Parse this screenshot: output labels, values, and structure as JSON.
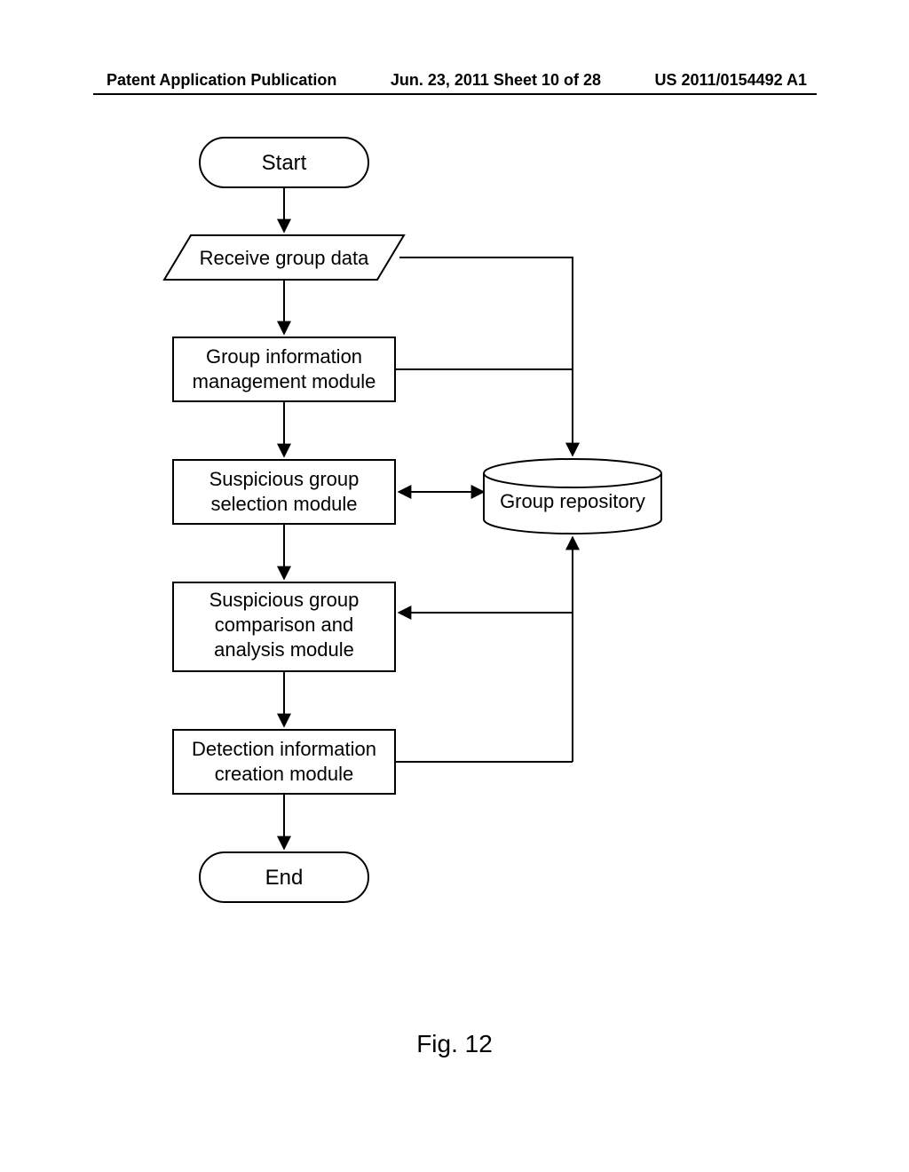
{
  "header": {
    "left": "Patent Application Publication",
    "center": "Jun. 23, 2011  Sheet 10 of 28",
    "right": "US 2011/0154492 A1"
  },
  "caption": "Fig. 12",
  "flow": {
    "start": "Start",
    "receive": "Receive group data",
    "gim1": "Group information",
    "gim2": "management module",
    "sgs1": "Suspicious group",
    "sgs2": "selection module",
    "sgca1": "Suspicious group",
    "sgca2": "comparison and",
    "sgca3": "analysis module",
    "dic1": "Detection information",
    "dic2": "creation module",
    "end": "End",
    "repo": "Group repository"
  }
}
